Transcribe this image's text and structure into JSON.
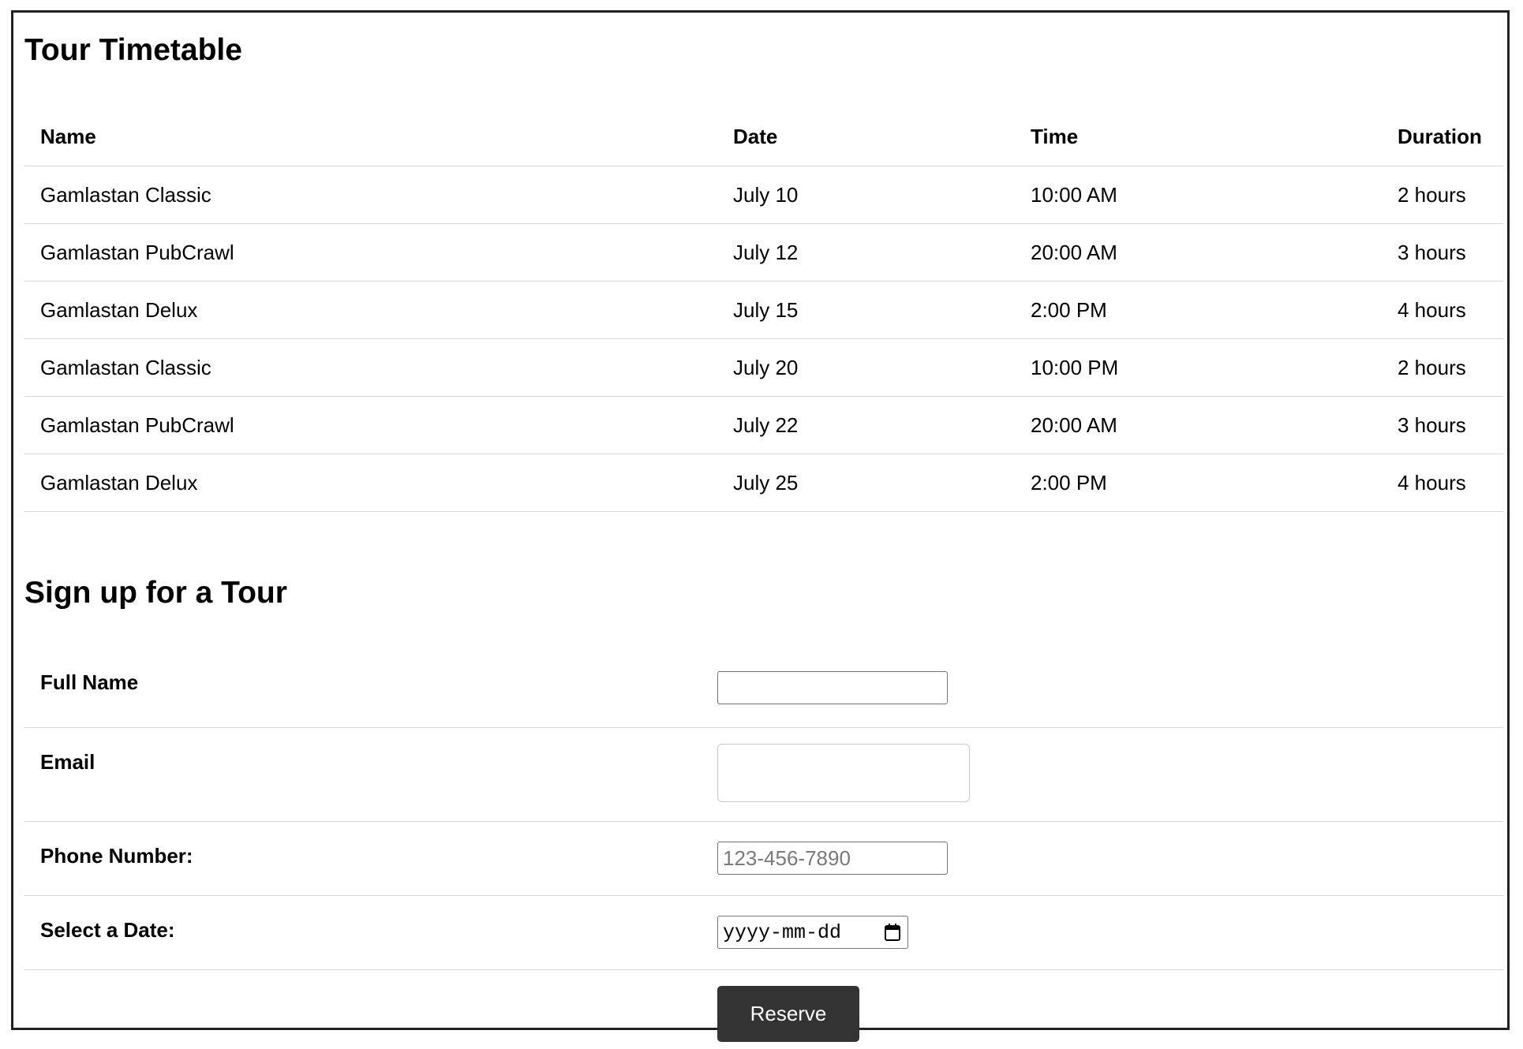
{
  "timetable": {
    "title": "Tour Timetable",
    "columns": [
      "Name",
      "Date",
      "Time",
      "Duration"
    ],
    "rows": [
      {
        "name": "Gamlastan Classic",
        "date": "July 10",
        "time": "10:00 AM",
        "duration": "2 hours"
      },
      {
        "name": "Gamlastan PubCrawl",
        "date": "July 12",
        "time": "20:00 AM",
        "duration": "3 hours"
      },
      {
        "name": "Gamlastan Delux",
        "date": "July 15",
        "time": "2:00 PM",
        "duration": "4 hours"
      },
      {
        "name": "Gamlastan Classic",
        "date": "July 20",
        "time": "10:00 PM",
        "duration": "2 hours"
      },
      {
        "name": "Gamlastan PubCrawl",
        "date": "July 22",
        "time": "20:00 AM",
        "duration": "3 hours"
      },
      {
        "name": "Gamlastan Delux",
        "date": "July 25",
        "time": "2:00 PM",
        "duration": "4 hours"
      }
    ]
  },
  "signup": {
    "title": "Sign up for a Tour",
    "full_name": {
      "label": "Full Name",
      "value": ""
    },
    "email": {
      "label": "Email",
      "value": ""
    },
    "phone": {
      "label": "Phone Number:",
      "value": "",
      "placeholder": "123-456-7890"
    },
    "date": {
      "label": "Select a Date:",
      "placeholder": "yyyy-mm-dd",
      "icon": "calendar-icon"
    },
    "submit_label": "Reserve"
  },
  "colors": {
    "button_bg": "#333333",
    "button_text": "#ffffff",
    "row_divider": "#d6d6d6",
    "frame_border": "#222222"
  }
}
